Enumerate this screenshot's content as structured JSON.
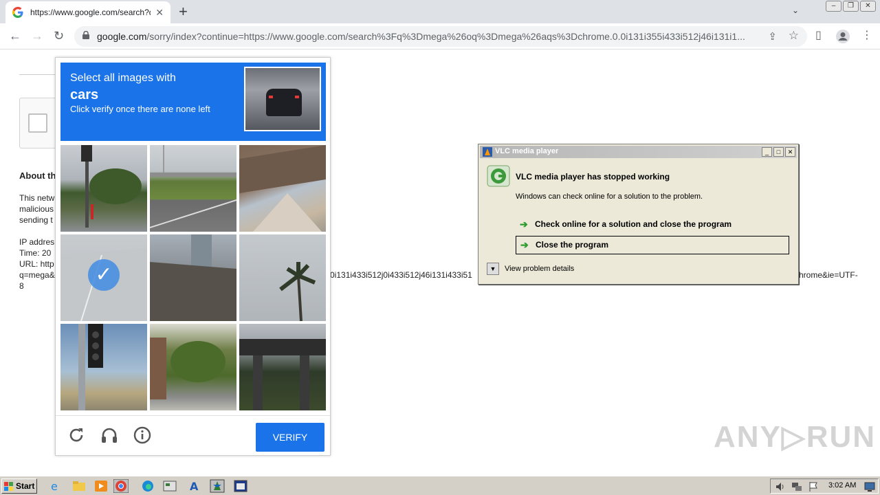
{
  "browser": {
    "tab_title": "https://www.google.com/search?q=",
    "url_host": "google.com",
    "url_path": "/sorry/index?continue=https://www.google.com/search%3Fq%3Dmega%26oq%3Dmega%26aqs%3Dchrome.0.0i131i355i433i512j46i131i1..."
  },
  "page": {
    "about_title": "About th",
    "body_lines": [
      "This netw",
      "malicious",
      "sending t"
    ],
    "ip_line": "IP addres",
    "time_line": "Time: 20",
    "url_line": "URL: http",
    "q_line": "q=mega&",
    "eight": "8",
    "url_mid": "0i131i433i512j0i433i512j46i131i433i51",
    "url_end": "hrome&ie=UTF-"
  },
  "captcha": {
    "line1": "Select all images with",
    "line2": "cars",
    "line3": "Click verify once there are none left",
    "verify_label": "VERIFY"
  },
  "vlc": {
    "title": "VLC media player",
    "heading": "VLC media player has stopped working",
    "subtext": "Windows can check online for a solution to the problem.",
    "option1": "Check online for a solution and close the program",
    "option2": "Close the program",
    "details": "View problem details"
  },
  "watermark": "ANY▷RUN",
  "taskbar": {
    "start_label": "Start",
    "clock": "3:02 AM"
  }
}
